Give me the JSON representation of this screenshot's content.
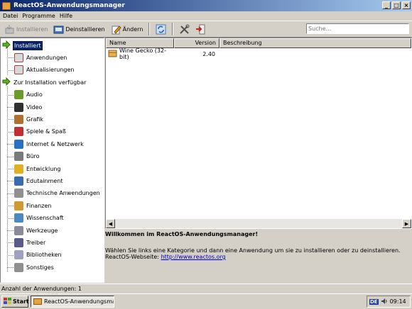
{
  "window": {
    "title": "ReactOS-Anwendungsmanager",
    "minimize": "_",
    "maximize": "□",
    "close": "×"
  },
  "menu": [
    "Datei",
    "Programme",
    "Hilfe"
  ],
  "toolbar": {
    "install_label": "Installieren",
    "uninstall_label": "Deinstallieren",
    "modify_label": "Ändern"
  },
  "search": {
    "placeholder": "Suche..."
  },
  "tree": {
    "installed": "Installiert",
    "installed_children": [
      "Anwendungen",
      "Aktualisierungen"
    ],
    "available": "Zur Installation verfügbar",
    "categories": [
      {
        "label": "Audio",
        "color": "#6a9a2a"
      },
      {
        "label": "Video",
        "color": "#303030"
      },
      {
        "label": "Grafik",
        "color": "#b07030"
      },
      {
        "label": "Spiele & Spaß",
        "color": "#c03030"
      },
      {
        "label": "Internet & Netzwerk",
        "color": "#2a70c0"
      },
      {
        "label": "Büro",
        "color": "#7a7a7a"
      },
      {
        "label": "Entwicklung",
        "color": "#e0b020"
      },
      {
        "label": "Edutainment",
        "color": "#3a6ab0"
      },
      {
        "label": "Technische Anwendungen",
        "color": "#909090"
      },
      {
        "label": "Finanzen",
        "color": "#d09a30"
      },
      {
        "label": "Wissenschaft",
        "color": "#4a8ac0"
      },
      {
        "label": "Werkzeuge",
        "color": "#8a8a9a"
      },
      {
        "label": "Treiber",
        "color": "#5a5a8a"
      },
      {
        "label": "Bibliotheken",
        "color": "#a0a0c0"
      },
      {
        "label": "Sonstiges",
        "color": "#909090"
      }
    ]
  },
  "list": {
    "columns": [
      "Name",
      "Version",
      "Beschreibung"
    ],
    "rows": [
      {
        "name": "Wine Gecko (32-bit)",
        "version": "2.40",
        "description": ""
      }
    ]
  },
  "description": {
    "title": "Willkommen im ReactOS-Anwendungsmanager!",
    "text": "Wählen Sie links eine Kategorie und dann eine Anwendung um sie zu installieren oder zu deinstallieren.",
    "website_label": "ReactOS-Webseite:",
    "website_url": "http://www.reactos.org"
  },
  "status": {
    "text": "Anzahl der Anwendungen: 1"
  },
  "taskbar": {
    "start": "Start",
    "task": "ReactOS-Anwendungsman...",
    "lang": "DE",
    "clock": "09:14"
  }
}
